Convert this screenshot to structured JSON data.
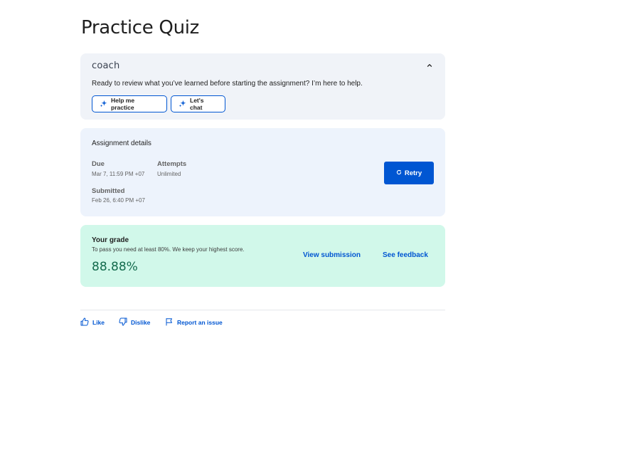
{
  "page": {
    "title": "Practice Quiz"
  },
  "coach": {
    "logo": "coach",
    "message": "Ready to review what you’ve learned before starting the assignment? I’m here to help.",
    "buttons": [
      {
        "label": "Help me practice",
        "icon": "sparkle-icon"
      },
      {
        "label": "Let's chat",
        "icon": "sparkle-icon"
      }
    ],
    "toggle_icon": "chevron-up-icon"
  },
  "details": {
    "heading": "Assignment details",
    "due_label": "Due",
    "due_value": "Mar 7, 11:59 PM +07",
    "attempts_label": "Attempts",
    "attempts_value": "Unlimited",
    "submitted_label": "Submitted",
    "submitted_value": "Feb 26, 6:40 PM +07",
    "retry_label": "Retry",
    "retry_icon": "refresh-icon"
  },
  "grade": {
    "heading": "Your grade",
    "subtext": "To pass you need at least 80%. We keep your highest score.",
    "score": "88.88%",
    "view_submission": "View submission",
    "see_feedback": "See feedback"
  },
  "feedback": {
    "like": "Like",
    "dislike": "Dislike",
    "report": "Report an issue"
  },
  "colors": {
    "accent": "#0056d2",
    "coach_bg": "#f0f3f8",
    "details_bg": "#edf3fc",
    "grade_bg": "#d1f8ea",
    "score": "#136b4d"
  }
}
